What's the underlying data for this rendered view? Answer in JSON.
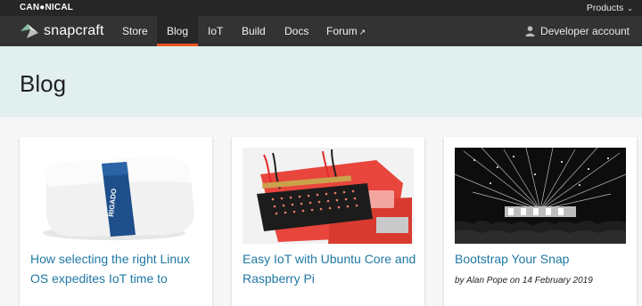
{
  "topbar": {
    "brand": "CAN●NICAL",
    "products_label": "Products",
    "chevron": "⌄"
  },
  "navbar": {
    "logo_text": "snapcraft",
    "items": [
      {
        "label": "Store"
      },
      {
        "label": "Blog"
      },
      {
        "label": "IoT"
      },
      {
        "label": "Build"
      },
      {
        "label": "Docs"
      },
      {
        "label": "Forum"
      }
    ],
    "active": "Blog",
    "account_label": "Developer account"
  },
  "hero": {
    "title": "Blog"
  },
  "cards": [
    {
      "title": "How selecting the right Linux OS expedites IoT time to",
      "image_icon": "rigado-gateway-image",
      "device_label": "RIGADO"
    },
    {
      "title": "Easy IoT with Ubuntu Core and Raspberry Pi",
      "image_icon": "raspberry-pi-hat-image"
    },
    {
      "title": "Bootstrap Your Snap",
      "byline_prefix": "by",
      "author": "Alan Pope",
      "byline_mid": "on",
      "date": "14 February 2019",
      "image_icon": "concert-crowd-image"
    }
  ],
  "colors": {
    "accent": "#e95420",
    "link": "#1f78a4",
    "hero_bg": "#e2efef",
    "nav_bg": "#333333",
    "topbar_bg": "#262626"
  }
}
